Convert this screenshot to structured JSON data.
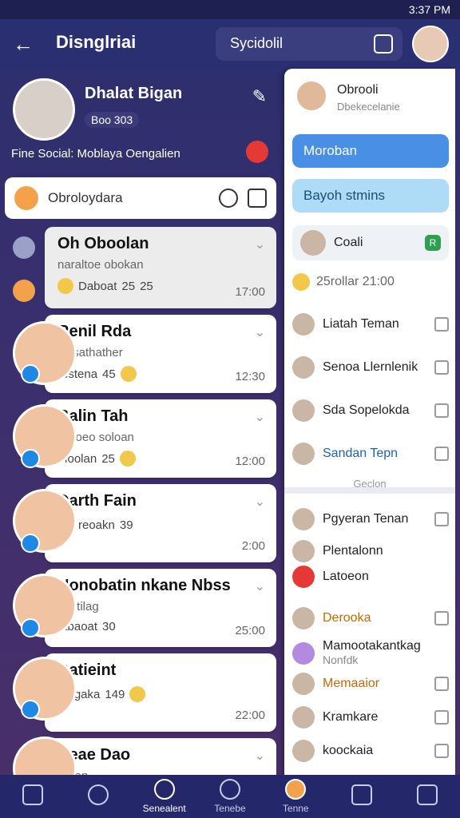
{
  "status": {
    "time": "3:37 PM"
  },
  "appbar": {
    "title": "Disnglriai",
    "search": "Sycidolil"
  },
  "profile": {
    "name": "Dhalat Bigan",
    "stats": "Boo 303",
    "desc": "Fine Social: Moblaya Oengalien"
  },
  "filter": {
    "label": "Obroloydara"
  },
  "chats": [
    {
      "name": "Oh Oboolan",
      "sub": "naraltoe obokan",
      "meta": "Daboat",
      "n1": "25",
      "n2": "25",
      "time": "17:00"
    },
    {
      "name": "Renil Rda",
      "sub": "Rasathather",
      "meta": "restena",
      "n1": "45",
      "time": "12:30"
    },
    {
      "name": "Balin Tah",
      "sub": "lasloeo soloan",
      "meta": "Moolan",
      "n1": "25",
      "time": "12:00"
    },
    {
      "name": "Darth Fain",
      "sub": "",
      "meta": "reoakn",
      "n1": "39",
      "time": "2:00"
    },
    {
      "name": "Nonobatin nkane Nbss",
      "sub": "bastilag",
      "meta": "tabaoat",
      "n1": "30",
      "time": "25:00"
    },
    {
      "name": "Datieint",
      "sub": "",
      "meta": "Mogaka",
      "n1": "149",
      "time": "22:00"
    },
    {
      "name": "Neae Dao",
      "sub": "Bolan",
      "meta": "",
      "time": ""
    }
  ],
  "right": {
    "head": {
      "title": "Obrooli",
      "sub": "Dbekecelanie"
    },
    "tile1": "Moroban",
    "tile2": "Bayoh stmins",
    "coal": "Coali",
    "stat": "25rollar 21:00",
    "list1": [
      "Liatah Teman",
      "Senoa Llernlenik",
      "Sda Sopelokda",
      "Sandan Tepn"
    ],
    "footer": "Geclon",
    "list2": [
      "Pgyeran Tenan",
      "Plentalonn",
      "Latoeon",
      "Derooka",
      "Mamootakantkag",
      "Memaaior",
      "Kramkare",
      "koockaia"
    ],
    "list2sub": "Nonfdk"
  },
  "bottom": [
    "",
    "",
    "Senealent",
    "Tenebe",
    "Tenne",
    "",
    ""
  ]
}
